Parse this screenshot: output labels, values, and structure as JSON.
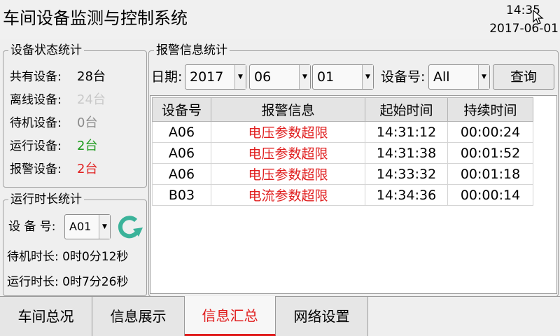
{
  "header": {
    "title": "车间设备监测与控制系统",
    "time": "14:35",
    "date": "2017-06-01"
  },
  "device_status": {
    "legend": "设备状态统计",
    "rows": [
      {
        "label": "共有设备:",
        "value": "28台",
        "color": "#000000"
      },
      {
        "label": "离线设备:",
        "value": "24台",
        "color": "#c8c8c8"
      },
      {
        "label": "待机设备:",
        "value": "0台",
        "color": "#8a8a8a"
      },
      {
        "label": "运行设备:",
        "value": "2台",
        "color": "#1a9a1a"
      },
      {
        "label": "报警设备:",
        "value": "2台",
        "color": "#e02020"
      }
    ]
  },
  "runtime": {
    "legend": "运行时长统计",
    "device_label": "设 备 号:",
    "device_value": "A01",
    "standby_label": "待机时长: 0时0分12秒",
    "running_label": "运行时长: 0时7分26秒",
    "refresh_color": "#3bb39a"
  },
  "alarm": {
    "legend": "报警信息统计",
    "date_label": "日期:",
    "year": "2017",
    "month": "06",
    "day": "01",
    "device_label": "设备号:",
    "device_value": "All",
    "query_button": "查询",
    "columns": [
      "设备号",
      "报警信息",
      "起始时间",
      "持续时间"
    ],
    "rows": [
      [
        "A06",
        "电压参数超限",
        "14:31:12",
        "00:00:24"
      ],
      [
        "A06",
        "电压参数超限",
        "14:31:38",
        "00:01:52"
      ],
      [
        "A06",
        "电压参数超限",
        "14:33:32",
        "00:01:18"
      ],
      [
        "B03",
        "电流参数超限",
        "14:34:36",
        "00:00:14"
      ]
    ]
  },
  "tabs": [
    {
      "label": "车间总况",
      "active": false
    },
    {
      "label": "信息展示",
      "active": false
    },
    {
      "label": "信息汇总",
      "active": true
    },
    {
      "label": "网络设置",
      "active": false
    }
  ],
  "colors": {
    "alarm_text": "#e02020",
    "active_tab": "#e01c1c"
  }
}
